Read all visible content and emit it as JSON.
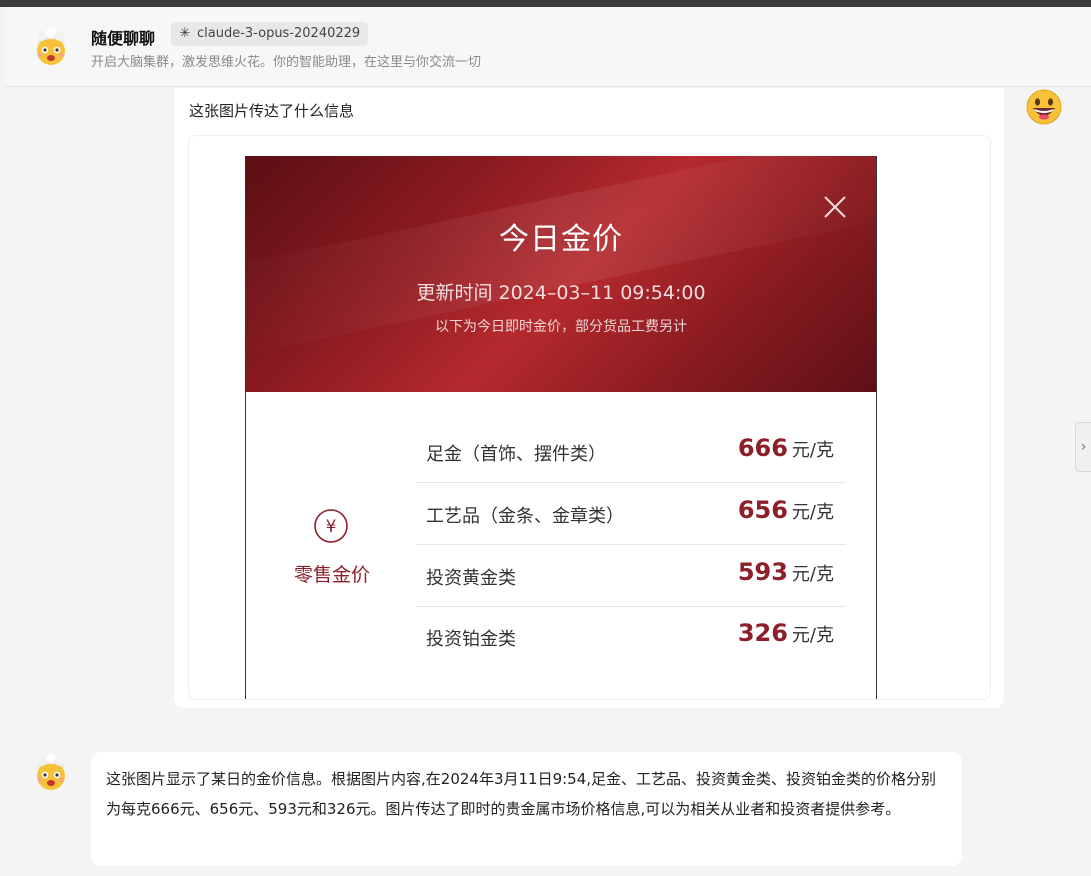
{
  "header": {
    "title": "随便聊聊",
    "model": "claude-3-opus-20240229",
    "subtitle": "开启大脑集群，激发思维火花。你的智能助理，在这里与你交流一切",
    "avatar_icon": "exploding-head-icon"
  },
  "user_message": {
    "text": "这张图片传达了什么信息",
    "avatar_icon": "grinning-face-icon",
    "image": {
      "title": "今日金价",
      "update_time": "更新时间 2024–03–11 09:54:00",
      "note": "以下为今日即时金价，部分货品工费另计",
      "category_label": "零售金价",
      "category_icon": "yuan-icon",
      "close_icon": "close-icon",
      "prices": [
        {
          "name": "足金（首饰、摆件类）",
          "value": "666",
          "unit": "元/克"
        },
        {
          "name": "工艺品（金条、金章类）",
          "value": "656",
          "unit": "元/克"
        },
        {
          "name": "投资黄金类",
          "value": "593",
          "unit": "元/克"
        },
        {
          "name": "投资铂金类",
          "value": "326",
          "unit": "元/克"
        }
      ],
      "colors": {
        "accent": "#8c1f2a",
        "header_red": "#b52a2e"
      }
    }
  },
  "assistant_message": {
    "text": "这张图片显示了某日的金价信息。根据图片内容,在2024年3月11日9:54,足金、工艺品、投资黄金类、投资铂金类的价格分别为每克666元、656元、593元和326元。图片传达了即时的贵金属市场价格信息,可以为相关从业者和投资者提供参考。",
    "avatar_icon": "exploding-head-icon"
  },
  "side_panel": {
    "toggle_icon": "chevron-right-icon"
  }
}
